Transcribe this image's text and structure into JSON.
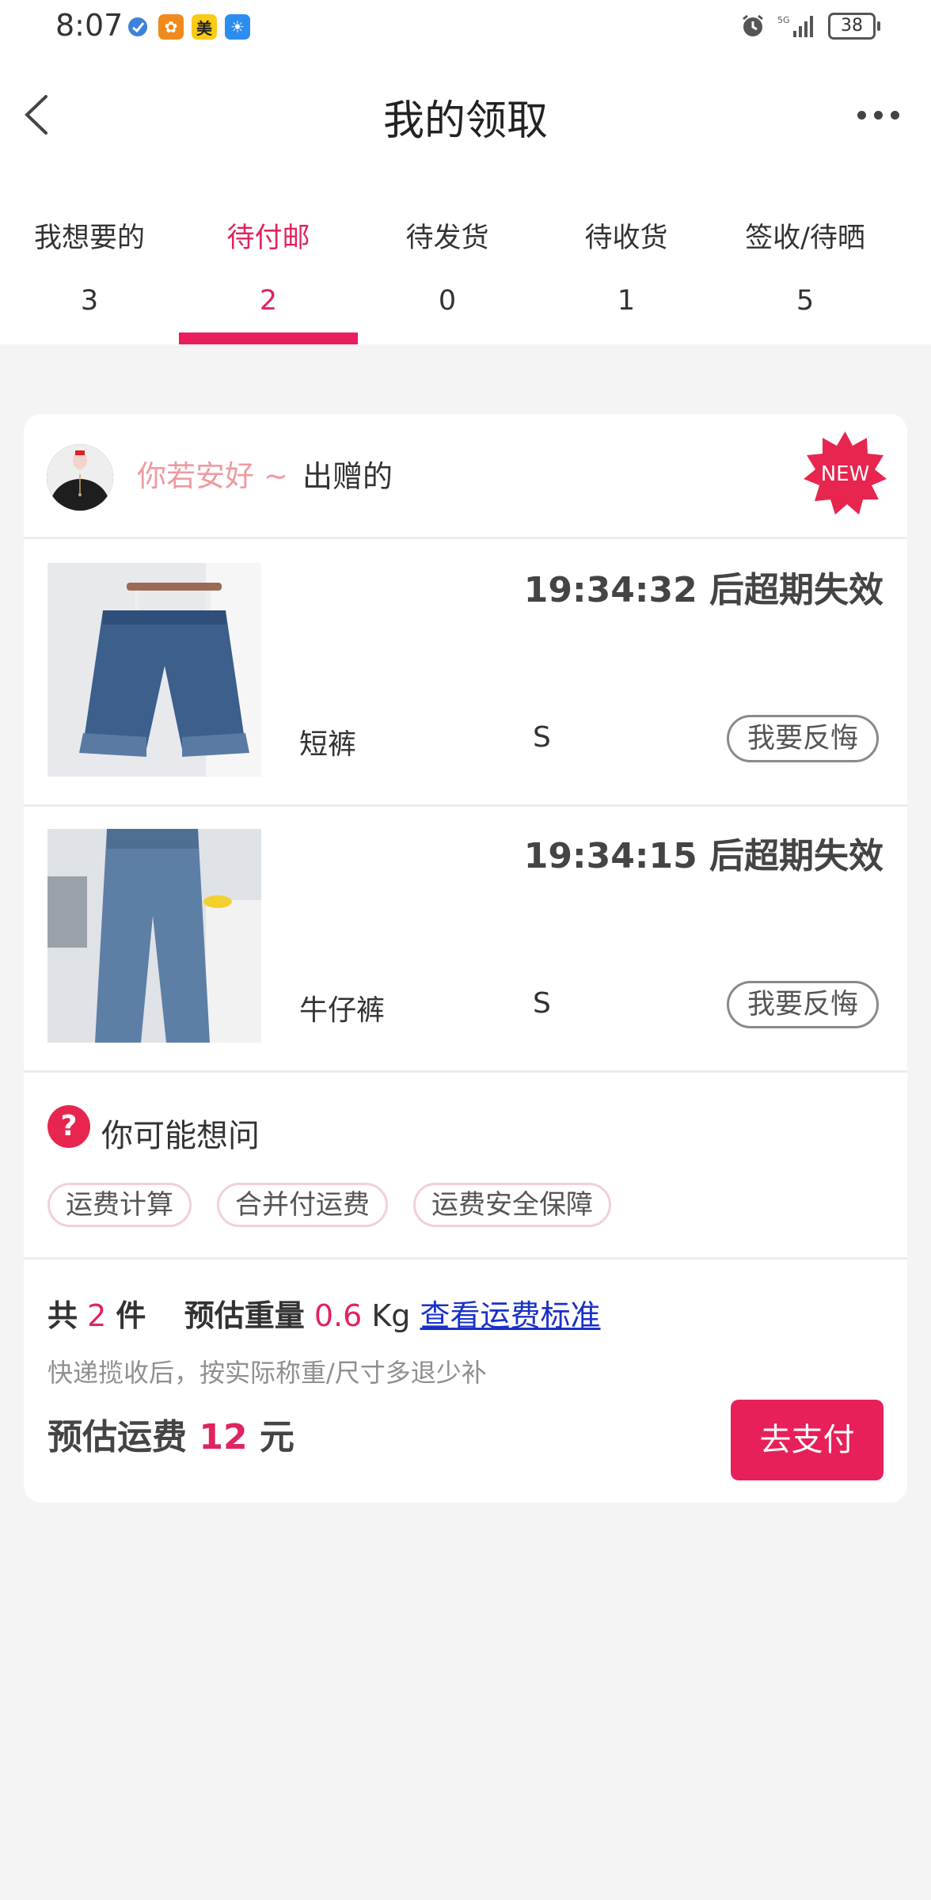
{
  "status_bar": {
    "time": "8:07",
    "battery": "38",
    "network": "5G"
  },
  "header": {
    "title": "我的领取"
  },
  "tabs": [
    {
      "label": "我想要的",
      "count": "3"
    },
    {
      "label": "待付邮",
      "count": "2"
    },
    {
      "label": "待发货",
      "count": "0"
    },
    {
      "label": "待收货",
      "count": "1"
    },
    {
      "label": "签收/待晒",
      "count": "5"
    }
  ],
  "active_tab": "待付邮",
  "order": {
    "giver_name": "你若安好 ~",
    "giver_suffix": "出赠的",
    "new_badge": "NEW",
    "items": [
      {
        "name": "短裤",
        "size": "S",
        "deadline": "19:34:32 后超期失效",
        "action": "我要反悔"
      },
      {
        "name": "牛仔裤",
        "size": "S",
        "deadline": "19:34:15 后超期失效",
        "action": "我要反悔"
      }
    ]
  },
  "faq": {
    "title": "你可能想问",
    "tags": [
      "运费计算",
      "合并付运费",
      "运费安全保障"
    ]
  },
  "summary": {
    "total_prefix": "共",
    "total_count": "2",
    "total_unit": "件",
    "weight_label": "预估重量",
    "weight_value": "0.6",
    "weight_unit": "Kg",
    "link_text": "查看运费标准",
    "note": "快递揽收后，按实际称重/尺寸多退少补",
    "fee_label": "预估运费",
    "fee_value": "12",
    "fee_unit": "元",
    "pay_button": "去支付"
  },
  "colors": {
    "accent": "#e8205a",
    "giver_name": "#ee9aa0",
    "link": "#1a31c8",
    "background": "#f4f4f4"
  }
}
